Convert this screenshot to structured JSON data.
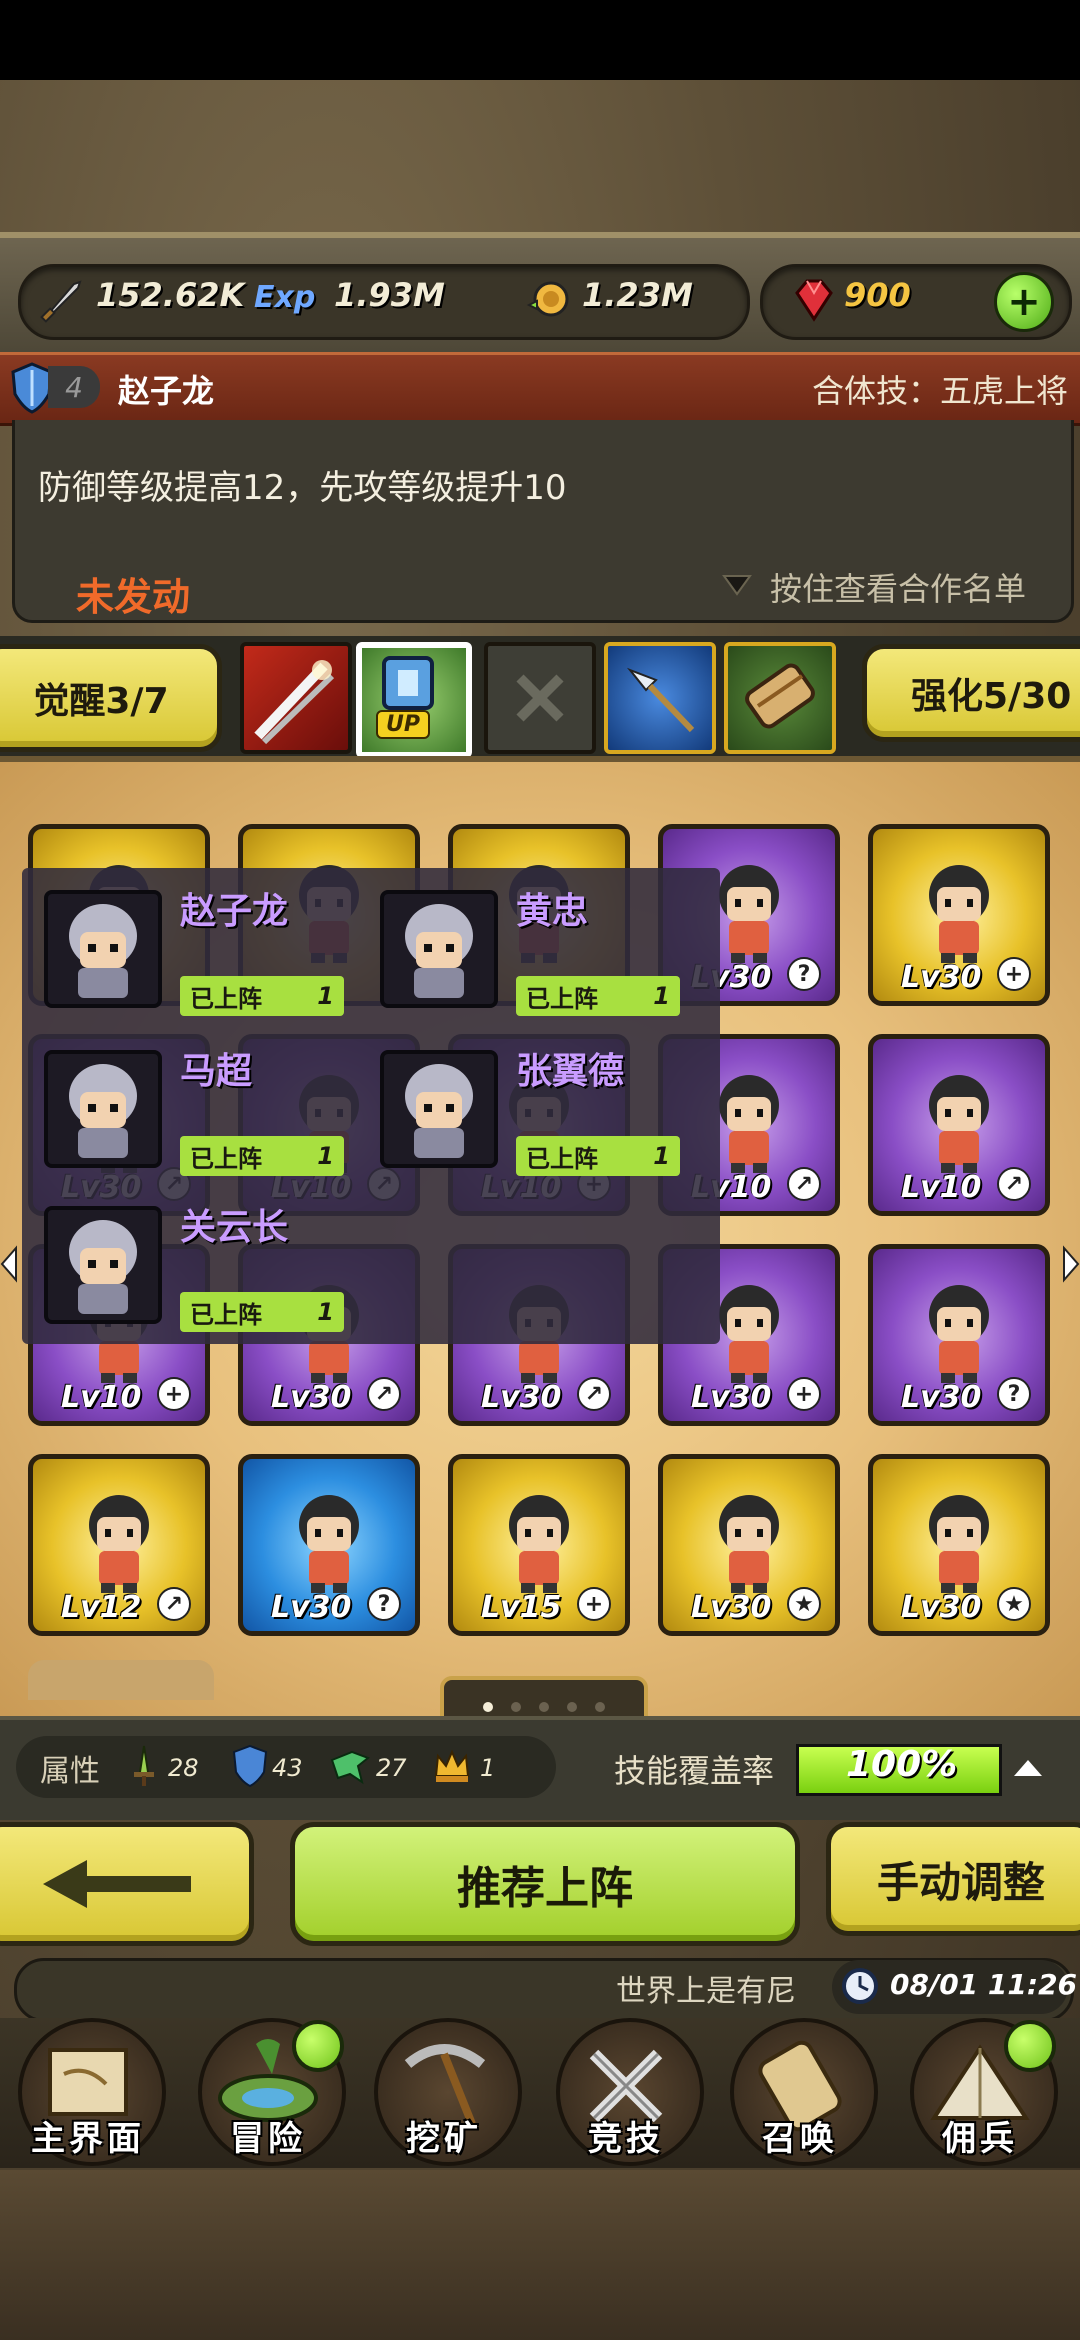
{
  "resources": {
    "attack": "152.62K",
    "exp_icon_text": "Exp",
    "exp": "1.93M",
    "gold": "1.23M",
    "gems": "900"
  },
  "combo": {
    "rank": "4",
    "hero_name": "赵子龙",
    "combo_skill": "合体技：五虎上将",
    "description": "防御等级提高12，先攻等级提升10",
    "status": "未发动",
    "hint": "按住查看合作名单"
  },
  "awaken": {
    "awaken_label": "觉醒3/7",
    "enhance_label": "强化5/30",
    "up_label": "UP"
  },
  "grid": [
    {
      "rarity": "gold",
      "lv": ""
    },
    {
      "rarity": "gold",
      "lv": ""
    },
    {
      "rarity": "gold",
      "lv": ""
    },
    {
      "rarity": "purple",
      "lv": "Lv30",
      "badge": "?"
    },
    {
      "rarity": "gold",
      "lv": "Lv30",
      "badge": "+"
    },
    {
      "rarity": "purple",
      "lv": "Lv30",
      "badge": "↗"
    },
    {
      "rarity": "purple",
      "lv": "Lv10",
      "badge": "↗"
    },
    {
      "rarity": "purple",
      "lv": "Lv10",
      "badge": "+"
    },
    {
      "rarity": "purple",
      "lv": "Lv10",
      "badge": "↗"
    },
    {
      "rarity": "purple",
      "lv": "Lv10",
      "badge": "↗"
    },
    {
      "rarity": "purple",
      "lv": "Lv10",
      "badge": "+"
    },
    {
      "rarity": "purple",
      "lv": "Lv30",
      "badge": "↗"
    },
    {
      "rarity": "purple",
      "lv": "Lv30",
      "badge": "↗"
    },
    {
      "rarity": "purple",
      "lv": "Lv30",
      "badge": "+"
    },
    {
      "rarity": "purple",
      "lv": "Lv30",
      "badge": "?"
    },
    {
      "rarity": "gold",
      "lv": "Lv12",
      "badge": "↗"
    },
    {
      "rarity": "blue",
      "lv": "Lv30",
      "badge": "?"
    },
    {
      "rarity": "gold",
      "lv": "Lv15",
      "badge": "+"
    },
    {
      "rarity": "gold",
      "lv": "Lv30",
      "badge": "★"
    },
    {
      "rarity": "gold",
      "lv": "Lv30",
      "badge": "★"
    }
  ],
  "overlay": {
    "members": [
      {
        "name": "赵子龙",
        "tag": "已上阵",
        "count": "1"
      },
      {
        "name": "黄忠",
        "tag": "已上阵",
        "count": "1"
      },
      {
        "name": "马超",
        "tag": "已上阵",
        "count": "1"
      },
      {
        "name": "张翼德",
        "tag": "已上阵",
        "count": "1"
      },
      {
        "name": "关云长",
        "tag": "已上阵",
        "count": "1"
      }
    ]
  },
  "attributes": {
    "label": "属性",
    "sword": "28",
    "shield": "43",
    "dragon": "27",
    "crown": "1",
    "coverage_label": "技能覆盖率",
    "coverage_value": "100%",
    "coverage_fraction": 1.0
  },
  "actions": {
    "recommend": "推荐上阵",
    "manual": "手动调整"
  },
  "chat": {
    "text": "世界上是有尼",
    "time": "08/01 11:26"
  },
  "nav": [
    {
      "label": "主界面",
      "icon": "scroll-map-icon",
      "badge": false
    },
    {
      "label": "冒险",
      "icon": "island-icon",
      "badge": true
    },
    {
      "label": "挖矿",
      "icon": "pickaxe-icon",
      "badge": false
    },
    {
      "label": "竞技",
      "icon": "crossed-swords-icon",
      "badge": false
    },
    {
      "label": "召唤",
      "icon": "summon-scroll-icon",
      "badge": false
    },
    {
      "label": "佣兵",
      "icon": "tent-icon",
      "badge": true
    }
  ]
}
